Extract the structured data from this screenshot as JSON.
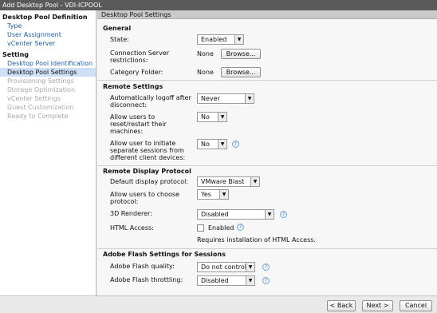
{
  "window": {
    "title": "Add Desktop Pool - VDI-ICPOOL"
  },
  "sidebar": {
    "sections": [
      {
        "title": "Desktop Pool Definition",
        "items": [
          "Type",
          "User Assignment",
          "vCenter Server"
        ]
      },
      {
        "title": "Setting",
        "items": [
          "Desktop Pool Identification",
          "Desktop Pool Settings",
          "Provisioning Settings",
          "Storage Optimization",
          "vCenter Settings",
          "Guest Customization",
          "Ready to Complete"
        ]
      }
    ],
    "selected": "Desktop Pool Settings"
  },
  "main": {
    "header": "Desktop Pool Settings",
    "general": {
      "title": "General",
      "state_label": "State:",
      "state_value": "Enabled",
      "cs_label_1": "Connection Server",
      "cs_label_2": "restrictions:",
      "cs_value": "None",
      "browse": "Browse...",
      "category_label": "Category Folder:",
      "category_value": "None"
    },
    "remote": {
      "title": "Remote Settings",
      "logoff_label_1": "Automatically logoff after",
      "logoff_label_2": "disconnect:",
      "logoff_value": "Never",
      "reset_label_1": "Allow users to",
      "reset_label_2": "reset/restart their",
      "reset_label_3": "machines:",
      "reset_value": "No",
      "separate_label_1": "Allow user to initiate",
      "separate_label_2": "separate sessions from",
      "separate_label_3": "different client devices:",
      "separate_value": "No"
    },
    "display": {
      "title": "Remote Display Protocol",
      "default_label": "Default display protocol:",
      "default_value": "VMware Blast",
      "choose_label_1": "Allow users to choose",
      "choose_label_2": "protocol:",
      "choose_value": "Yes",
      "renderer_label": "3D Renderer:",
      "renderer_value": "Disabled",
      "html_label": "HTML Access:",
      "html_checkbox_label": "Enabled",
      "html_note": "Requires installation of HTML Access."
    },
    "flash": {
      "title": "Adobe Flash Settings for Sessions",
      "quality_label": "Adobe Flash quality:",
      "quality_value": "Do not control",
      "throttling_label": "Adobe Flash throttling:",
      "throttling_value": "Disabled"
    }
  },
  "footer": {
    "back": "< Back",
    "next": "Next >",
    "cancel": "Cancel"
  }
}
